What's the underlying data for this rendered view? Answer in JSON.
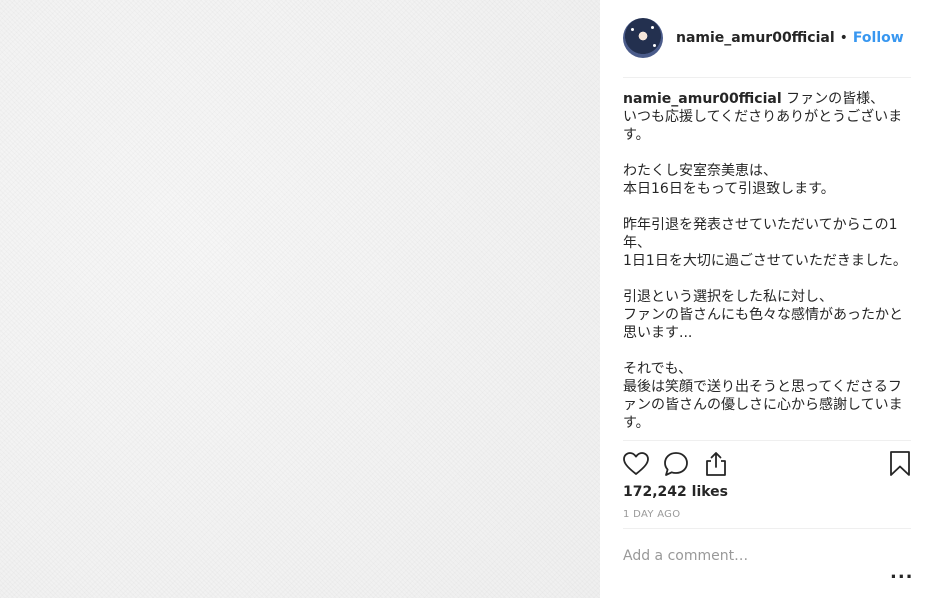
{
  "post": {
    "username": "namie_amur00fficial",
    "dot": "•",
    "follow_label": "Follow",
    "caption": {
      "username": "namie_amur00fficial",
      "text": " ファンの皆様、\nいつも応援してくださりありがとうございます。\n\nわたくし安室奈美恵は、\n本日16日をもって引退致します。\n\n昨年引退を発表させていただいてからこの1年、\n1日1日を大切に過ごさせていただきました。\n\n引退という選択をした私に対し、\nファンの皆さんにも色々な感情があったかと思います...\n\nそれでも、\n最後は笑顔で送り出そうと思ってくださるファンの皆さんの優しさに心から感謝しています。"
    },
    "actions": {
      "like_icon": "heart-icon",
      "comment_icon": "comment-icon",
      "share_icon": "share-icon",
      "save_icon": "bookmark-icon"
    },
    "likes": "172,242 likes",
    "time_ago": "1 DAY AGO",
    "comment_placeholder": "Add a comment…",
    "more_label": "..."
  },
  "colors": {
    "link": "#3897f0",
    "text": "#262626",
    "muted": "#999999"
  }
}
